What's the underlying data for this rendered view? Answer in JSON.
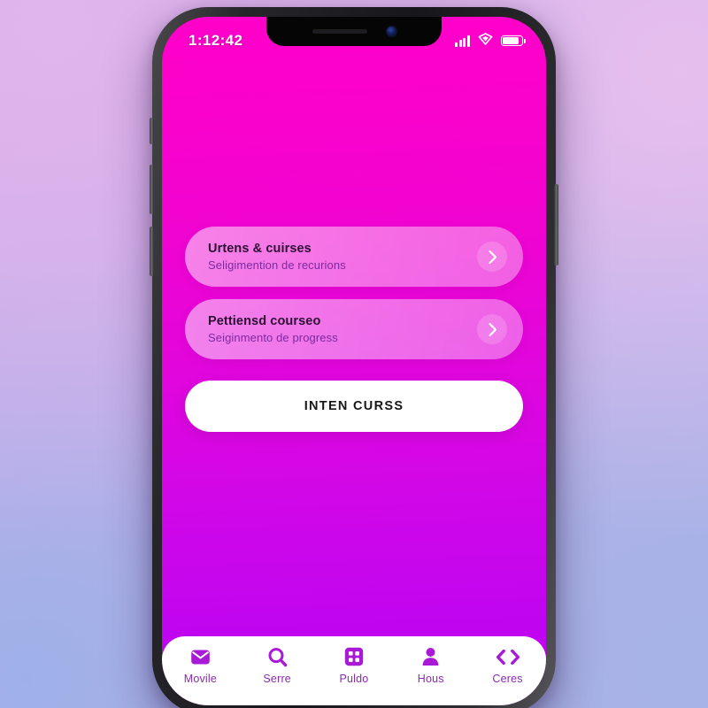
{
  "theme": {
    "screen_gradient_top": "#ff00c8",
    "screen_gradient_bottom": "#bb00f2",
    "accent_purple": "#a81ad6",
    "nav_label_color": "#8a2ab0",
    "card_title_color": "#2c1033",
    "card_sub_color": "#7c2aa0",
    "background_top_left": "#d9aee8",
    "background_bottom_right": "#a8b5e8",
    "device_frame": "#17171b",
    "cta_background": "#ffffff"
  },
  "status_bar": {
    "time": "1:12:42",
    "icons": [
      {
        "name": "signal-icon",
        "bars": 4
      },
      {
        "name": "wifi-icon"
      },
      {
        "name": "battery-icon",
        "level_percent": 88
      }
    ]
  },
  "notch": {
    "speaker_icon": "speaker-grille",
    "camera_icon": "front-camera"
  },
  "main": {
    "cards": [
      {
        "title": "Urtens & cuirses",
        "subtitle": "Seligimention de recurions",
        "chevron_icon": "chevron-right-icon"
      },
      {
        "title": "Pettiensd courseo",
        "subtitle": "Seiginmento de progress",
        "chevron_icon": "chevron-right-icon"
      }
    ],
    "cta_label": "INTEN CURSS"
  },
  "bottom_nav": {
    "items": [
      {
        "label": "Movile",
        "icon": "mail-icon"
      },
      {
        "label": "Serre",
        "icon": "search-icon"
      },
      {
        "label": "Puldo",
        "icon": "grid-icon"
      },
      {
        "label": "Hous",
        "icon": "person-icon"
      },
      {
        "label": "Ceres",
        "icon": "arrows-left-right-icon"
      }
    ]
  }
}
